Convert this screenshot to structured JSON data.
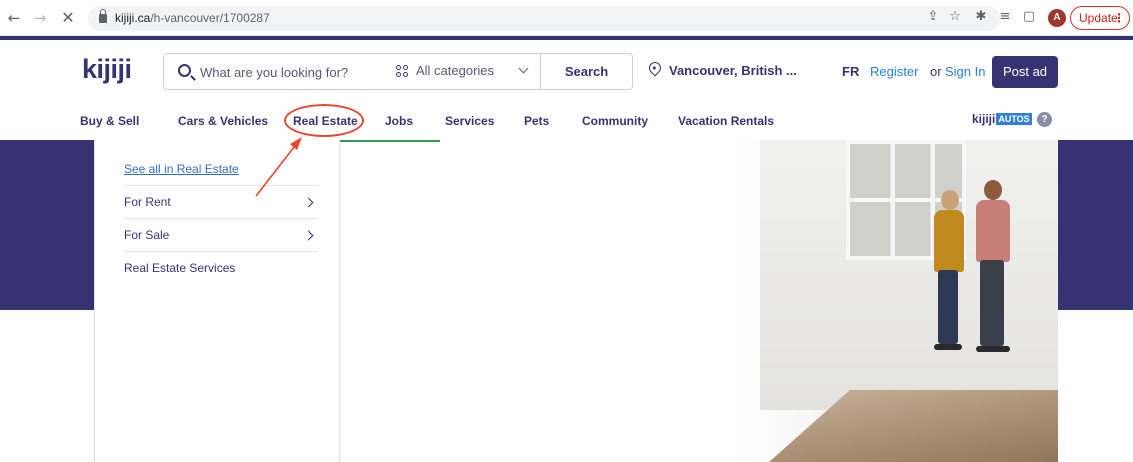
{
  "browser": {
    "url_host": "kijiji.ca",
    "url_path": "/h-vancouver/1700287",
    "update_label": "Update",
    "profile_initial": "A",
    "icons": [
      "back-arrow-icon",
      "forward-arrow-icon",
      "stop-icon",
      "lock-icon",
      "share-icon",
      "star-icon",
      "extensions-icon",
      "reading-list-icon",
      "split-view-icon",
      "menu-dots-icon"
    ]
  },
  "header": {
    "logo": "kijiji",
    "search": {
      "placeholder": "What are you looking for?"
    },
    "categories_label": "All categories",
    "search_button": "Search",
    "location": "Vancouver, British ...",
    "lang": "FR",
    "register": "Register",
    "or": "or",
    "sign_in": "Sign In",
    "post_ad": "Post ad",
    "brand_color": "#373373"
  },
  "nav": {
    "items": [
      "Buy & Sell",
      "Cars & Vehicles",
      "Real Estate",
      "Jobs",
      "Services",
      "Pets",
      "Community",
      "Vacation Rentals"
    ],
    "autos_prefix": "kijiji",
    "autos_badge": "AUTOS",
    "help": "?"
  },
  "dropdown": {
    "items": [
      {
        "label": "See all in Real Estate",
        "has_submenu": false
      },
      {
        "label": "For Rent",
        "has_submenu": true
      },
      {
        "label": "For Sale",
        "has_submenu": true
      },
      {
        "label": "Real Estate Services",
        "has_submenu": false
      }
    ]
  },
  "annotation_color": "#e8462e"
}
